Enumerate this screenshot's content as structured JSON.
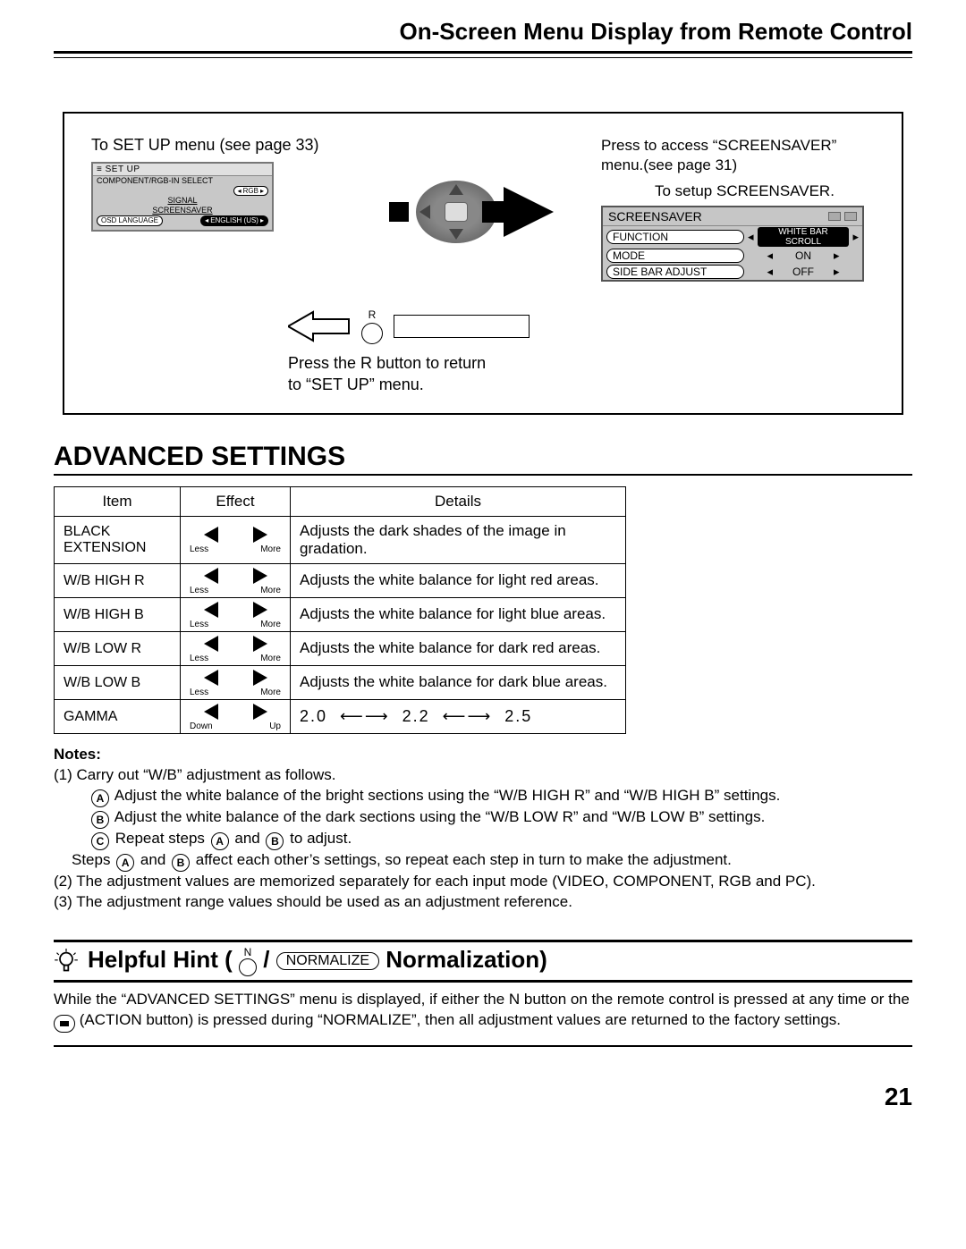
{
  "header": "On-Screen Menu Display from Remote Control",
  "diagram": {
    "setup_caption": "To SET UP menu (see page 33)",
    "setup_menu": {
      "title": "SET UP",
      "rows": [
        {
          "label": "COMPONENT/RGB-IN SELECT",
          "value": "RGB"
        },
        {
          "label": "SIGNAL",
          "value": ""
        },
        {
          "label": "SCREENSAVER",
          "value": ""
        },
        {
          "label": "OSD LANGUAGE",
          "value": "ENGLISH (US)"
        }
      ]
    },
    "press_access": "Press to access “SCREENSAVER” menu.(see page 31)",
    "to_setup_ss": "To setup SCREENSAVER.",
    "screensaver_menu": {
      "title": "SCREENSAVER",
      "rows": [
        {
          "label": "FUNCTION",
          "value": "WHITE BAR SCROLL",
          "dark": true
        },
        {
          "label": "MODE",
          "value": "ON",
          "dark": false
        },
        {
          "label": "SIDE BAR ADJUST",
          "value": "OFF",
          "dark": false
        }
      ]
    },
    "r_label": "R",
    "r_caption_1": "Press the R button to return",
    "r_caption_2": "to “SET UP” menu."
  },
  "advanced_title": "ADVANCED SETTINGS",
  "table": {
    "headers": [
      "Item",
      "Effect",
      "Details"
    ],
    "rows": [
      {
        "item": "BLACK EXTENSION",
        "left": "Less",
        "right": "More",
        "details": "Adjusts the dark shades of the image in gradation."
      },
      {
        "item": "W/B HIGH R",
        "left": "Less",
        "right": "More",
        "details": "Adjusts the white balance for light red areas."
      },
      {
        "item": "W/B HIGH B",
        "left": "Less",
        "right": "More",
        "details": "Adjusts the white balance for light blue areas."
      },
      {
        "item": "W/B LOW R",
        "left": "Less",
        "right": "More",
        "details": "Adjusts the white balance for dark red areas."
      },
      {
        "item": "W/B LOW B",
        "left": "Less",
        "right": "More",
        "details": "Adjusts the white balance for dark blue areas."
      },
      {
        "item": "GAMMA",
        "left": "Down",
        "right": "Up",
        "details_gamma": [
          "2.0",
          "2.2",
          "2.5"
        ]
      }
    ]
  },
  "notes": {
    "title": "Notes:",
    "n1": "(1) Carry out “W/B” adjustment as follows.",
    "nA": "Adjust the white balance of the bright sections using the “W/B HIGH R” and “W/B HIGH B” settings.",
    "nB": "Adjust the white balance of the dark sections using the “W/B LOW R” and “W/B LOW B” settings.",
    "nC_pre": "Repeat steps ",
    "nC_mid": " and ",
    "nC_post": " to adjust.",
    "steps_line_pre": "Steps ",
    "steps_line_mid": " and ",
    "steps_line_post": " affect each other’s settings, so repeat each step in turn to make the adjustment.",
    "n2": "(2) The adjustment values are memorized separately for each input mode (VIDEO, COMPONENT, RGB and PC).",
    "n3": "(3) The adjustment range values should be used as an adjustment reference."
  },
  "hint": {
    "title_pre": "Helpful Hint (",
    "n_letter": "N",
    "slash": " / ",
    "normalize": "NORMALIZE",
    "title_post": " Normalization)",
    "body_1": "While the “ADVANCED SETTINGS” menu is displayed, if either the N button on the remote control is pressed at any time or the ",
    "body_2": " (ACTION button) is pressed during “NORMALIZE”, then all adjustment values are returned to the factory settings."
  },
  "page_number": "21"
}
